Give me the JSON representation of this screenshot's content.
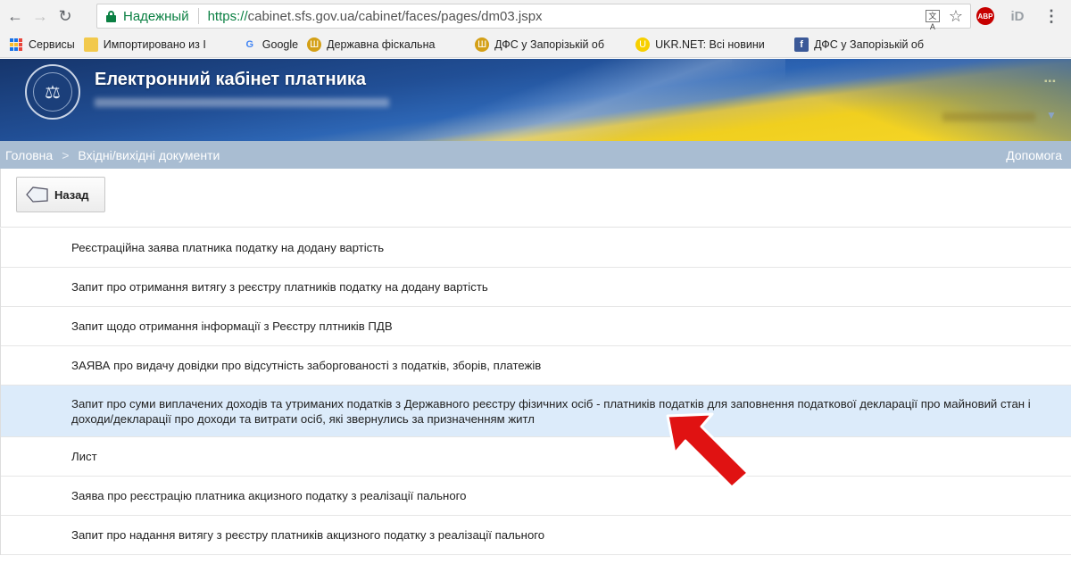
{
  "browser": {
    "secure_label": "Надежный",
    "url_proto": "https://",
    "url_rest": "cabinet.sfs.gov.ua/cabinet/faces/pages/dm03.jspx",
    "icons": [
      "back-arrow-icon",
      "forward-arrow-icon",
      "reload-icon",
      "lock-icon",
      "translate-icon",
      "star-icon",
      "abp-icon",
      "id-extension-icon",
      "menu-icon"
    ]
  },
  "bookmarks": [
    {
      "label": "Сервисы",
      "icon": "apps-grid-icon"
    },
    {
      "label": "Импортировано из I",
      "icon": "folder-icon"
    },
    {
      "label": "Google",
      "icon": "google-icon"
    },
    {
      "label": "Державна фіскальна",
      "icon": "trident-icon"
    },
    {
      "label": "ДФС у Запорізькій об",
      "icon": "trident-icon"
    },
    {
      "label": "UKR.NET: Всі новини",
      "icon": "ukrnet-icon"
    },
    {
      "label": "ДФС у Запорізькій об",
      "icon": "facebook-icon"
    }
  ],
  "header": {
    "title": "Електронний кабінет платника"
  },
  "breadcrumb": {
    "home": "Головна",
    "separator": ">",
    "current": "Вхідні/вихідні документи",
    "help": "Допомога"
  },
  "toolbar": {
    "back_label": "Назад"
  },
  "documents": [
    "Реєстраційна заява платника податку на додану вартість",
    "Запит про отримання витягу з реєстру платників податку на додану вартість",
    "Запит щодо отримання інформації з Реєстру плтників ПДВ",
    "ЗАЯВА про видачу довідки про відсутність заборгованості з податків, зборів, платежів",
    "Запит про суми виплачених доходів та утриманих податків з Державного реєстру фізичних осіб - платників податків для заповнення податкової декларації про майновий стан і доходи/декларації про доходи та витрати осіб, які звернулись за призначенням житл",
    "Лист",
    "Заява про реєстрацію платника акцизного податку з реалізації пального",
    "Запит про надання витягу з реєстру платників акцизного податку з реалізації пального"
  ],
  "highlight_color": "#dcebfa",
  "arrow_color": "#e01212"
}
